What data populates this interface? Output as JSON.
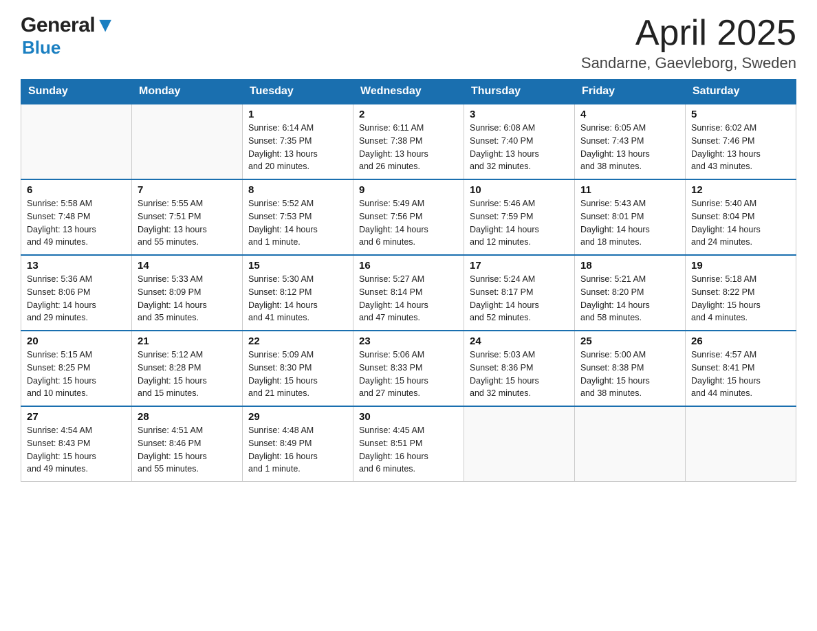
{
  "header": {
    "logo_general": "General",
    "logo_blue": "Blue",
    "month_title": "April 2025",
    "location": "Sandarne, Gaevleborg, Sweden"
  },
  "weekdays": [
    "Sunday",
    "Monday",
    "Tuesday",
    "Wednesday",
    "Thursday",
    "Friday",
    "Saturday"
  ],
  "weeks": [
    [
      {
        "day": "",
        "info": ""
      },
      {
        "day": "",
        "info": ""
      },
      {
        "day": "1",
        "info": "Sunrise: 6:14 AM\nSunset: 7:35 PM\nDaylight: 13 hours\nand 20 minutes."
      },
      {
        "day": "2",
        "info": "Sunrise: 6:11 AM\nSunset: 7:38 PM\nDaylight: 13 hours\nand 26 minutes."
      },
      {
        "day": "3",
        "info": "Sunrise: 6:08 AM\nSunset: 7:40 PM\nDaylight: 13 hours\nand 32 minutes."
      },
      {
        "day": "4",
        "info": "Sunrise: 6:05 AM\nSunset: 7:43 PM\nDaylight: 13 hours\nand 38 minutes."
      },
      {
        "day": "5",
        "info": "Sunrise: 6:02 AM\nSunset: 7:46 PM\nDaylight: 13 hours\nand 43 minutes."
      }
    ],
    [
      {
        "day": "6",
        "info": "Sunrise: 5:58 AM\nSunset: 7:48 PM\nDaylight: 13 hours\nand 49 minutes."
      },
      {
        "day": "7",
        "info": "Sunrise: 5:55 AM\nSunset: 7:51 PM\nDaylight: 13 hours\nand 55 minutes."
      },
      {
        "day": "8",
        "info": "Sunrise: 5:52 AM\nSunset: 7:53 PM\nDaylight: 14 hours\nand 1 minute."
      },
      {
        "day": "9",
        "info": "Sunrise: 5:49 AM\nSunset: 7:56 PM\nDaylight: 14 hours\nand 6 minutes."
      },
      {
        "day": "10",
        "info": "Sunrise: 5:46 AM\nSunset: 7:59 PM\nDaylight: 14 hours\nand 12 minutes."
      },
      {
        "day": "11",
        "info": "Sunrise: 5:43 AM\nSunset: 8:01 PM\nDaylight: 14 hours\nand 18 minutes."
      },
      {
        "day": "12",
        "info": "Sunrise: 5:40 AM\nSunset: 8:04 PM\nDaylight: 14 hours\nand 24 minutes."
      }
    ],
    [
      {
        "day": "13",
        "info": "Sunrise: 5:36 AM\nSunset: 8:06 PM\nDaylight: 14 hours\nand 29 minutes."
      },
      {
        "day": "14",
        "info": "Sunrise: 5:33 AM\nSunset: 8:09 PM\nDaylight: 14 hours\nand 35 minutes."
      },
      {
        "day": "15",
        "info": "Sunrise: 5:30 AM\nSunset: 8:12 PM\nDaylight: 14 hours\nand 41 minutes."
      },
      {
        "day": "16",
        "info": "Sunrise: 5:27 AM\nSunset: 8:14 PM\nDaylight: 14 hours\nand 47 minutes."
      },
      {
        "day": "17",
        "info": "Sunrise: 5:24 AM\nSunset: 8:17 PM\nDaylight: 14 hours\nand 52 minutes."
      },
      {
        "day": "18",
        "info": "Sunrise: 5:21 AM\nSunset: 8:20 PM\nDaylight: 14 hours\nand 58 minutes."
      },
      {
        "day": "19",
        "info": "Sunrise: 5:18 AM\nSunset: 8:22 PM\nDaylight: 15 hours\nand 4 minutes."
      }
    ],
    [
      {
        "day": "20",
        "info": "Sunrise: 5:15 AM\nSunset: 8:25 PM\nDaylight: 15 hours\nand 10 minutes."
      },
      {
        "day": "21",
        "info": "Sunrise: 5:12 AM\nSunset: 8:28 PM\nDaylight: 15 hours\nand 15 minutes."
      },
      {
        "day": "22",
        "info": "Sunrise: 5:09 AM\nSunset: 8:30 PM\nDaylight: 15 hours\nand 21 minutes."
      },
      {
        "day": "23",
        "info": "Sunrise: 5:06 AM\nSunset: 8:33 PM\nDaylight: 15 hours\nand 27 minutes."
      },
      {
        "day": "24",
        "info": "Sunrise: 5:03 AM\nSunset: 8:36 PM\nDaylight: 15 hours\nand 32 minutes."
      },
      {
        "day": "25",
        "info": "Sunrise: 5:00 AM\nSunset: 8:38 PM\nDaylight: 15 hours\nand 38 minutes."
      },
      {
        "day": "26",
        "info": "Sunrise: 4:57 AM\nSunset: 8:41 PM\nDaylight: 15 hours\nand 44 minutes."
      }
    ],
    [
      {
        "day": "27",
        "info": "Sunrise: 4:54 AM\nSunset: 8:43 PM\nDaylight: 15 hours\nand 49 minutes."
      },
      {
        "day": "28",
        "info": "Sunrise: 4:51 AM\nSunset: 8:46 PM\nDaylight: 15 hours\nand 55 minutes."
      },
      {
        "day": "29",
        "info": "Sunrise: 4:48 AM\nSunset: 8:49 PM\nDaylight: 16 hours\nand 1 minute."
      },
      {
        "day": "30",
        "info": "Sunrise: 4:45 AM\nSunset: 8:51 PM\nDaylight: 16 hours\nand 6 minutes."
      },
      {
        "day": "",
        "info": ""
      },
      {
        "day": "",
        "info": ""
      },
      {
        "day": "",
        "info": ""
      }
    ]
  ]
}
